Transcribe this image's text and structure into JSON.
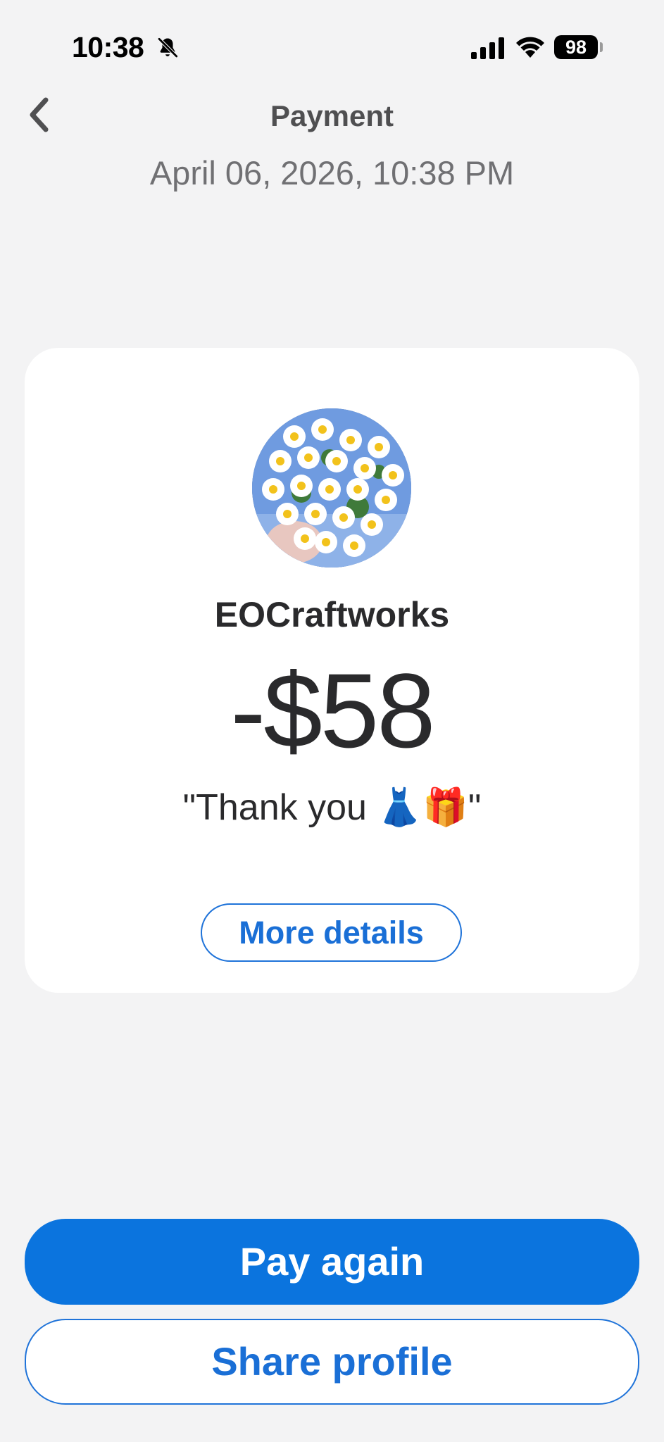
{
  "status_bar": {
    "time": "10:38",
    "battery_level": "98",
    "icons": [
      "bell-slash-icon",
      "cellular-signal-icon",
      "wifi-icon",
      "battery-icon"
    ]
  },
  "header": {
    "title": "Payment",
    "date": "April 06, 2026, 10:38 PM",
    "back_icon": "chevron-left-icon"
  },
  "card": {
    "avatar": "daisy-bouquet-profile-photo",
    "recipient": "EOCraftworks",
    "amount": "-$58",
    "note": "\"Thank you 👗🎁\"",
    "more_details_label": "More details"
  },
  "actions": {
    "pay_again_label": "Pay again",
    "share_profile_label": "Share profile"
  },
  "colors": {
    "accent": "#0b74de",
    "background": "#f3f3f4",
    "card": "#ffffff"
  }
}
